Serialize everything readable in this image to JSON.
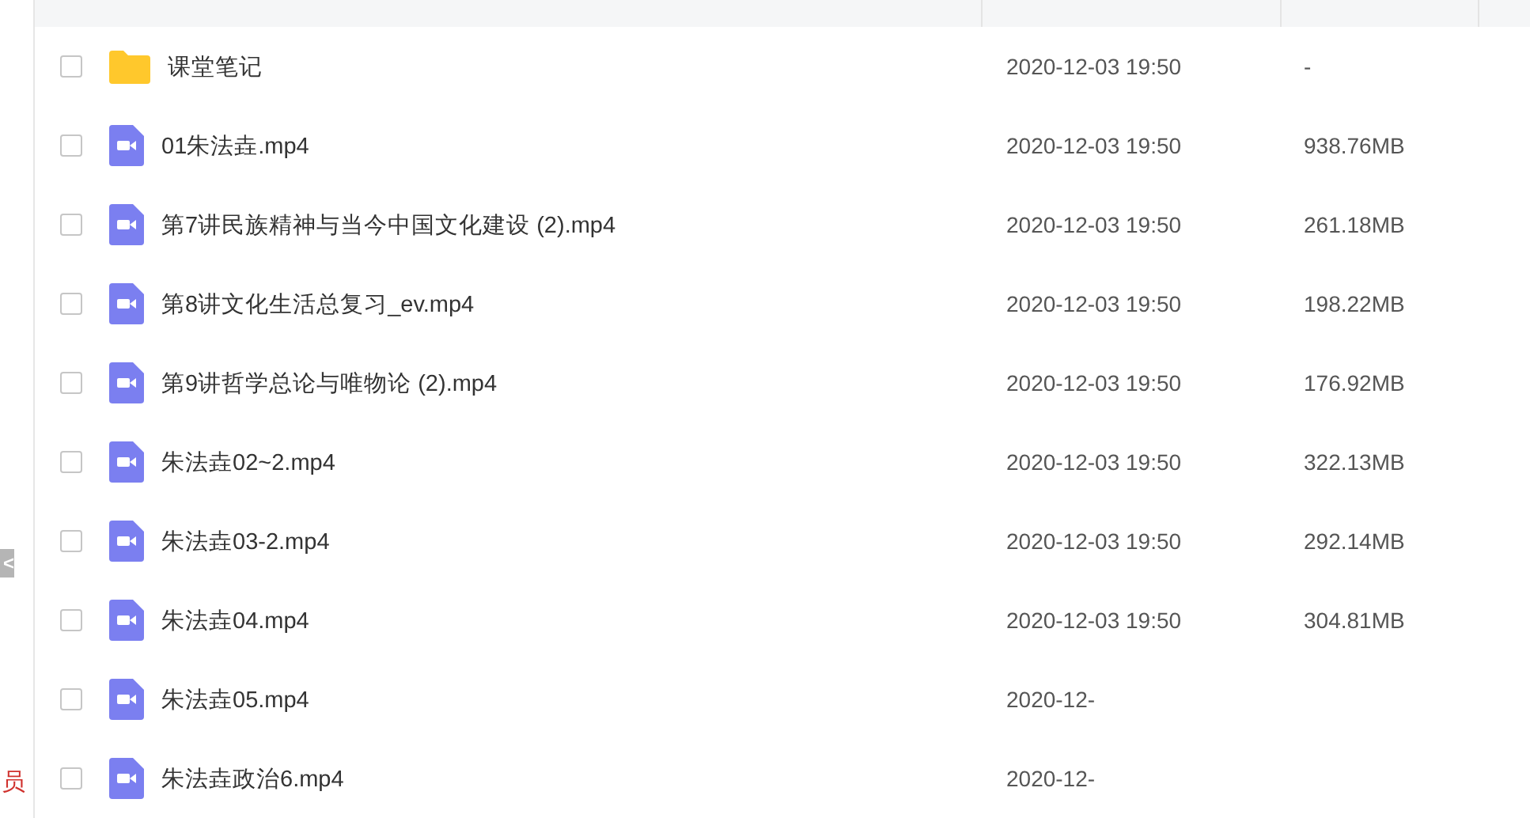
{
  "sidebar": {
    "collapse_button": "<",
    "footer_text": "员"
  },
  "files": [
    {
      "kind": "folder",
      "name": "课堂笔记",
      "modified": "2020-12-03 19:50",
      "size": "-",
      "checked": false
    },
    {
      "kind": "video",
      "name": "01朱法垚.mp4",
      "modified": "2020-12-03 19:50",
      "size": "938.76MB",
      "checked": false
    },
    {
      "kind": "video",
      "name": "第7讲民族精神与当今中国文化建设 (2).mp4",
      "modified": "2020-12-03 19:50",
      "size": "261.18MB",
      "checked": false
    },
    {
      "kind": "video",
      "name": "第8讲文化生活总复习_ev.mp4",
      "modified": "2020-12-03 19:50",
      "size": "198.22MB",
      "checked": false
    },
    {
      "kind": "video",
      "name": "第9讲哲学总论与唯物论 (2).mp4",
      "modified": "2020-12-03 19:50",
      "size": "176.92MB",
      "checked": false
    },
    {
      "kind": "video",
      "name": "朱法垚02~2.mp4",
      "modified": "2020-12-03 19:50",
      "size": "322.13MB",
      "checked": false
    },
    {
      "kind": "video",
      "name": "朱法垚03-2.mp4",
      "modified": "2020-12-03 19:50",
      "size": "292.14MB",
      "checked": false
    },
    {
      "kind": "video",
      "name": "朱法垚04.mp4",
      "modified": "2020-12-03 19:50",
      "size": "304.81MB",
      "checked": false
    },
    {
      "kind": "video",
      "name": "朱法垚05.mp4",
      "modified": "2020-12-",
      "checked": false
    },
    {
      "kind": "video",
      "name": "朱法垚政治6.mp4",
      "modified": "2020-12-",
      "checked": false
    }
  ]
}
